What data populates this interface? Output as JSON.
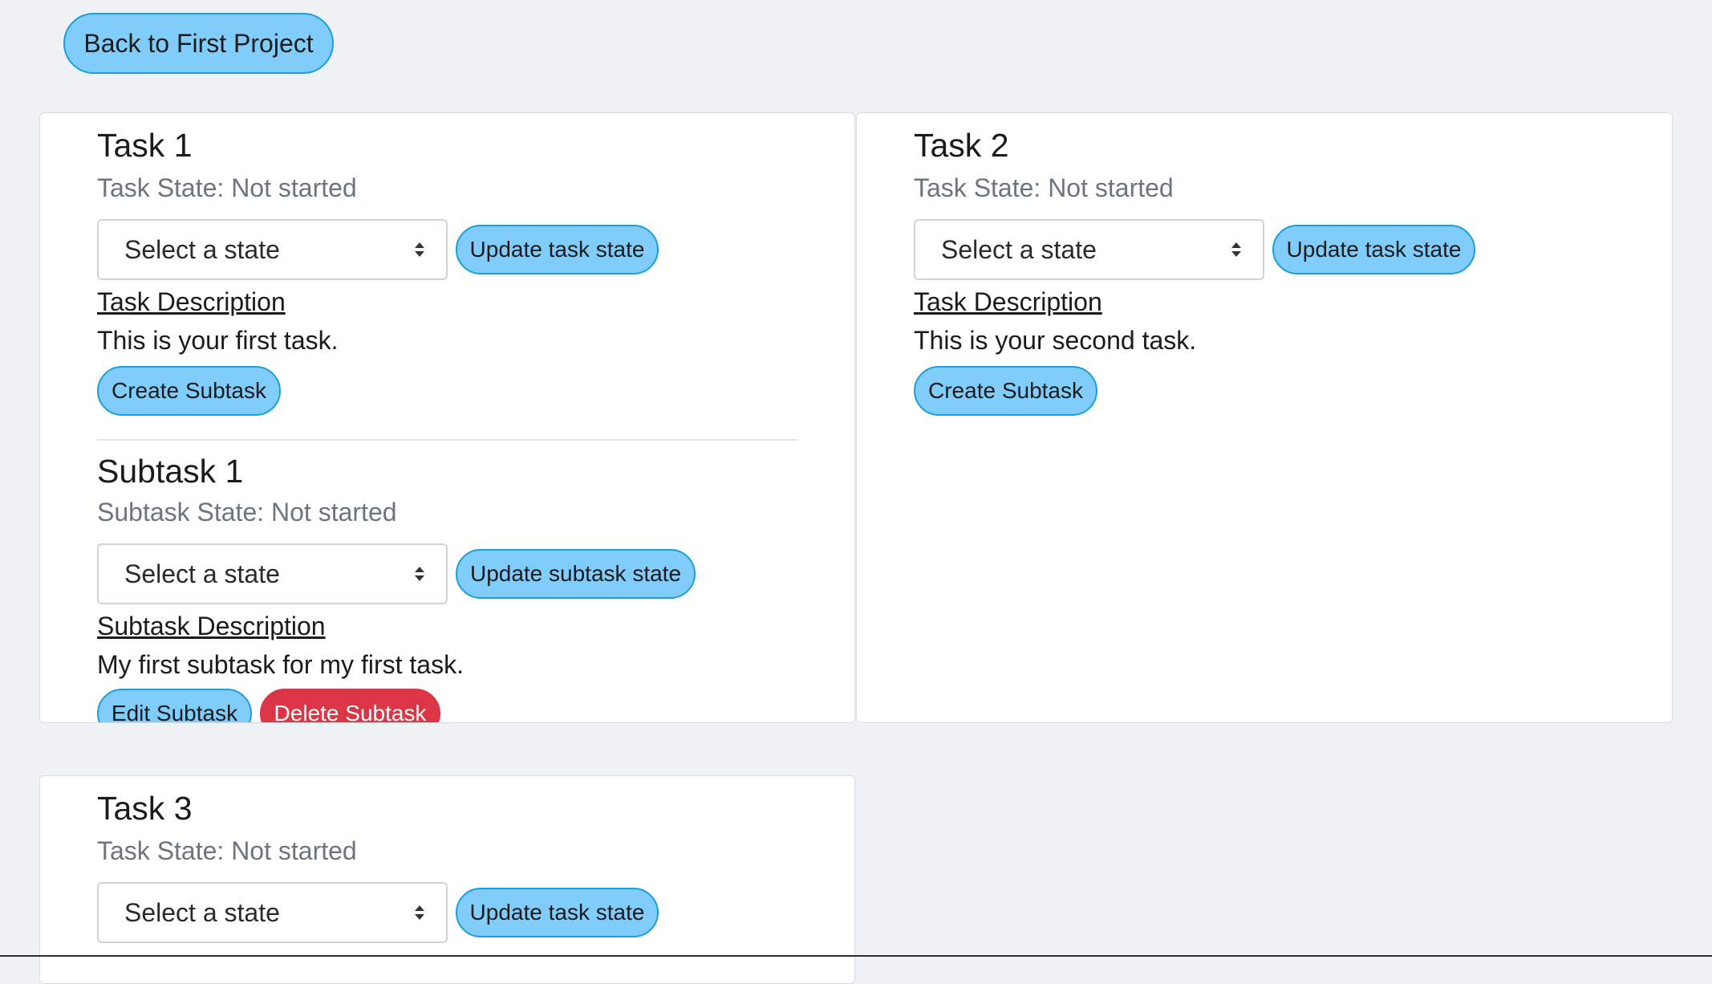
{
  "back_button": "Back to First Project",
  "tasks": [
    {
      "title": "Task 1",
      "state": "Task State: Not started",
      "select_value": "Select a state",
      "update_button": "Update task state",
      "description_heading": "Task Description",
      "description": "This is your first task.",
      "create_subtask_button": "Create Subtask",
      "subtasks": [
        {
          "title": "Subtask 1",
          "state": "Subtask State: Not started",
          "select_value": "Select a state",
          "update_button": "Update subtask state",
          "description_heading": "Subtask Description",
          "description": "My first subtask for my first task.",
          "edit_button": "Edit Subtask",
          "delete_button": "Delete Subtask"
        }
      ]
    },
    {
      "title": "Task 2",
      "state": "Task State: Not started",
      "select_value": "Select a state",
      "update_button": "Update task state",
      "description_heading": "Task Description",
      "description": "This is your second task.",
      "create_subtask_button": "Create Subtask"
    },
    {
      "title": "Task 3",
      "state": "Task State: Not started",
      "select_value": "Select a state",
      "update_button": "Update task state"
    }
  ],
  "colors": {
    "page_background": "#eff2f5",
    "primary_button": "#80ccfb",
    "primary_button_border": "#1aa0d8",
    "danger_button": "#dc3545",
    "muted_text": "#6c757d"
  },
  "icons": {
    "select_arrows": "chevron-up-down-icon"
  }
}
